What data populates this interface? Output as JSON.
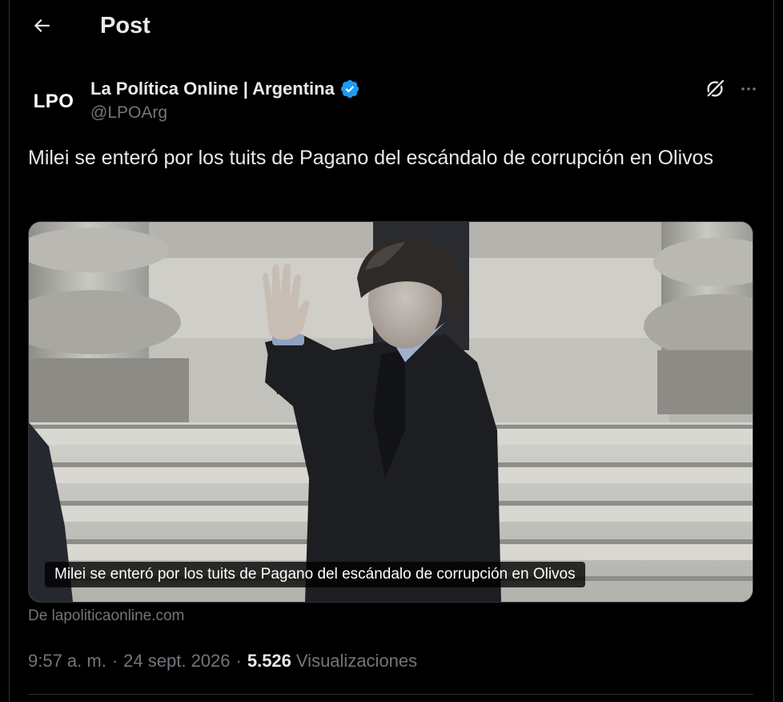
{
  "header": {
    "title": "Post",
    "back_icon": "arrow-left-icon"
  },
  "author": {
    "avatar_text": "LPO",
    "name": "La Política Online | Argentina",
    "handle": "@LPOArg",
    "verified": true,
    "verified_color": "#1d9bf0"
  },
  "post": {
    "text": "Milei se enteró por los tuits de Pagano del escándalo de corrupción en Olivos",
    "card": {
      "caption": "Milei se enteró por los tuits de Pagano del escándalo de corrupción en Olivos",
      "source": "De lapoliticaonline.com"
    },
    "meta": {
      "time": "9:57 a. m.",
      "date": "24 sept. 2026",
      "views_count": "5.526",
      "views_label": "Visualizaciones"
    }
  },
  "colors": {
    "background": "#000000",
    "text_primary": "#e7e9ea",
    "text_secondary": "#71767b",
    "border": "#2f3336"
  },
  "icons": {
    "grok": "grok-icon",
    "more": "more-dots-icon"
  }
}
